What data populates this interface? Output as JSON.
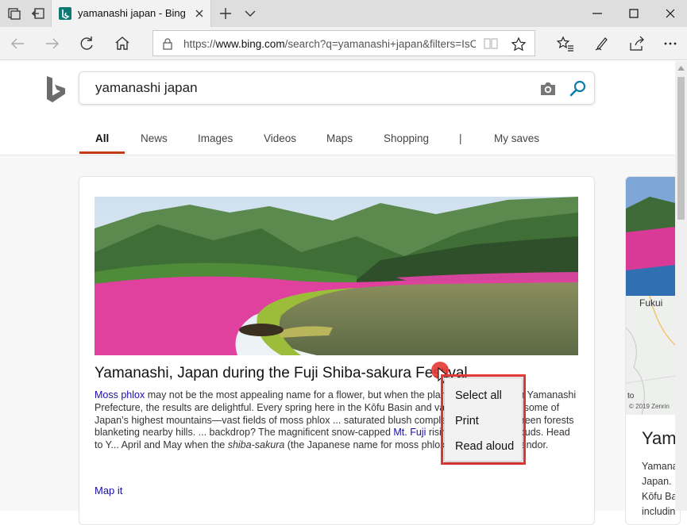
{
  "browser": {
    "tab_title": "yamanashi japan - Bing",
    "url_prefix": "https://",
    "url_host": "www.bing.com",
    "url_path": "/search?q=yamanashi+japan&filters=IsCon"
  },
  "search": {
    "query": "yamanashi japan",
    "scopes": [
      "All",
      "News",
      "Images",
      "Videos",
      "Maps",
      "Shopping",
      "|",
      "My saves"
    ],
    "active_scope": "All"
  },
  "card": {
    "title": "Yamanashi, Japan during the Fuji Shiba-sakura Festival",
    "body_link1": "Moss phlox",
    "body_part1": " may not be the most appealing name for a flower, but when the plants are blooming in Yamanashi Prefecture, the results are delightful. Every spring here in the Kōfu Basin and valley shadowed by some of Japan’s highest mountains—vast fields of moss phlox ... saturated blush complements the thick green forests blanketing nearby hills. ... backdrop? The magnificent snow-capped ",
    "body_link2": "Mt. Fuji",
    "body_part2": " rising high into the clouds. Head to Y... April and May when the ",
    "body_italic": "shiba-sakura",
    "body_part3": " (the Japanese name for moss phlox) colors the ... splendor.",
    "map_link": "Map it"
  },
  "sidebar": {
    "map_label": "Fukui",
    "map_to": "to",
    "map_credit": "© 2019 Zenrin",
    "title": "Yam",
    "lines": [
      "Yamana",
      "Japan. ",
      "Kōfu Ba",
      "includin"
    ]
  },
  "context_menu": {
    "items": [
      "Select all",
      "Print",
      "Read aloud"
    ]
  },
  "colors": {
    "accent_underline": "#c23d17",
    "link": "#1a0dab",
    "highlight_frame": "#e53935",
    "bing_teal": "#0b7a75"
  }
}
